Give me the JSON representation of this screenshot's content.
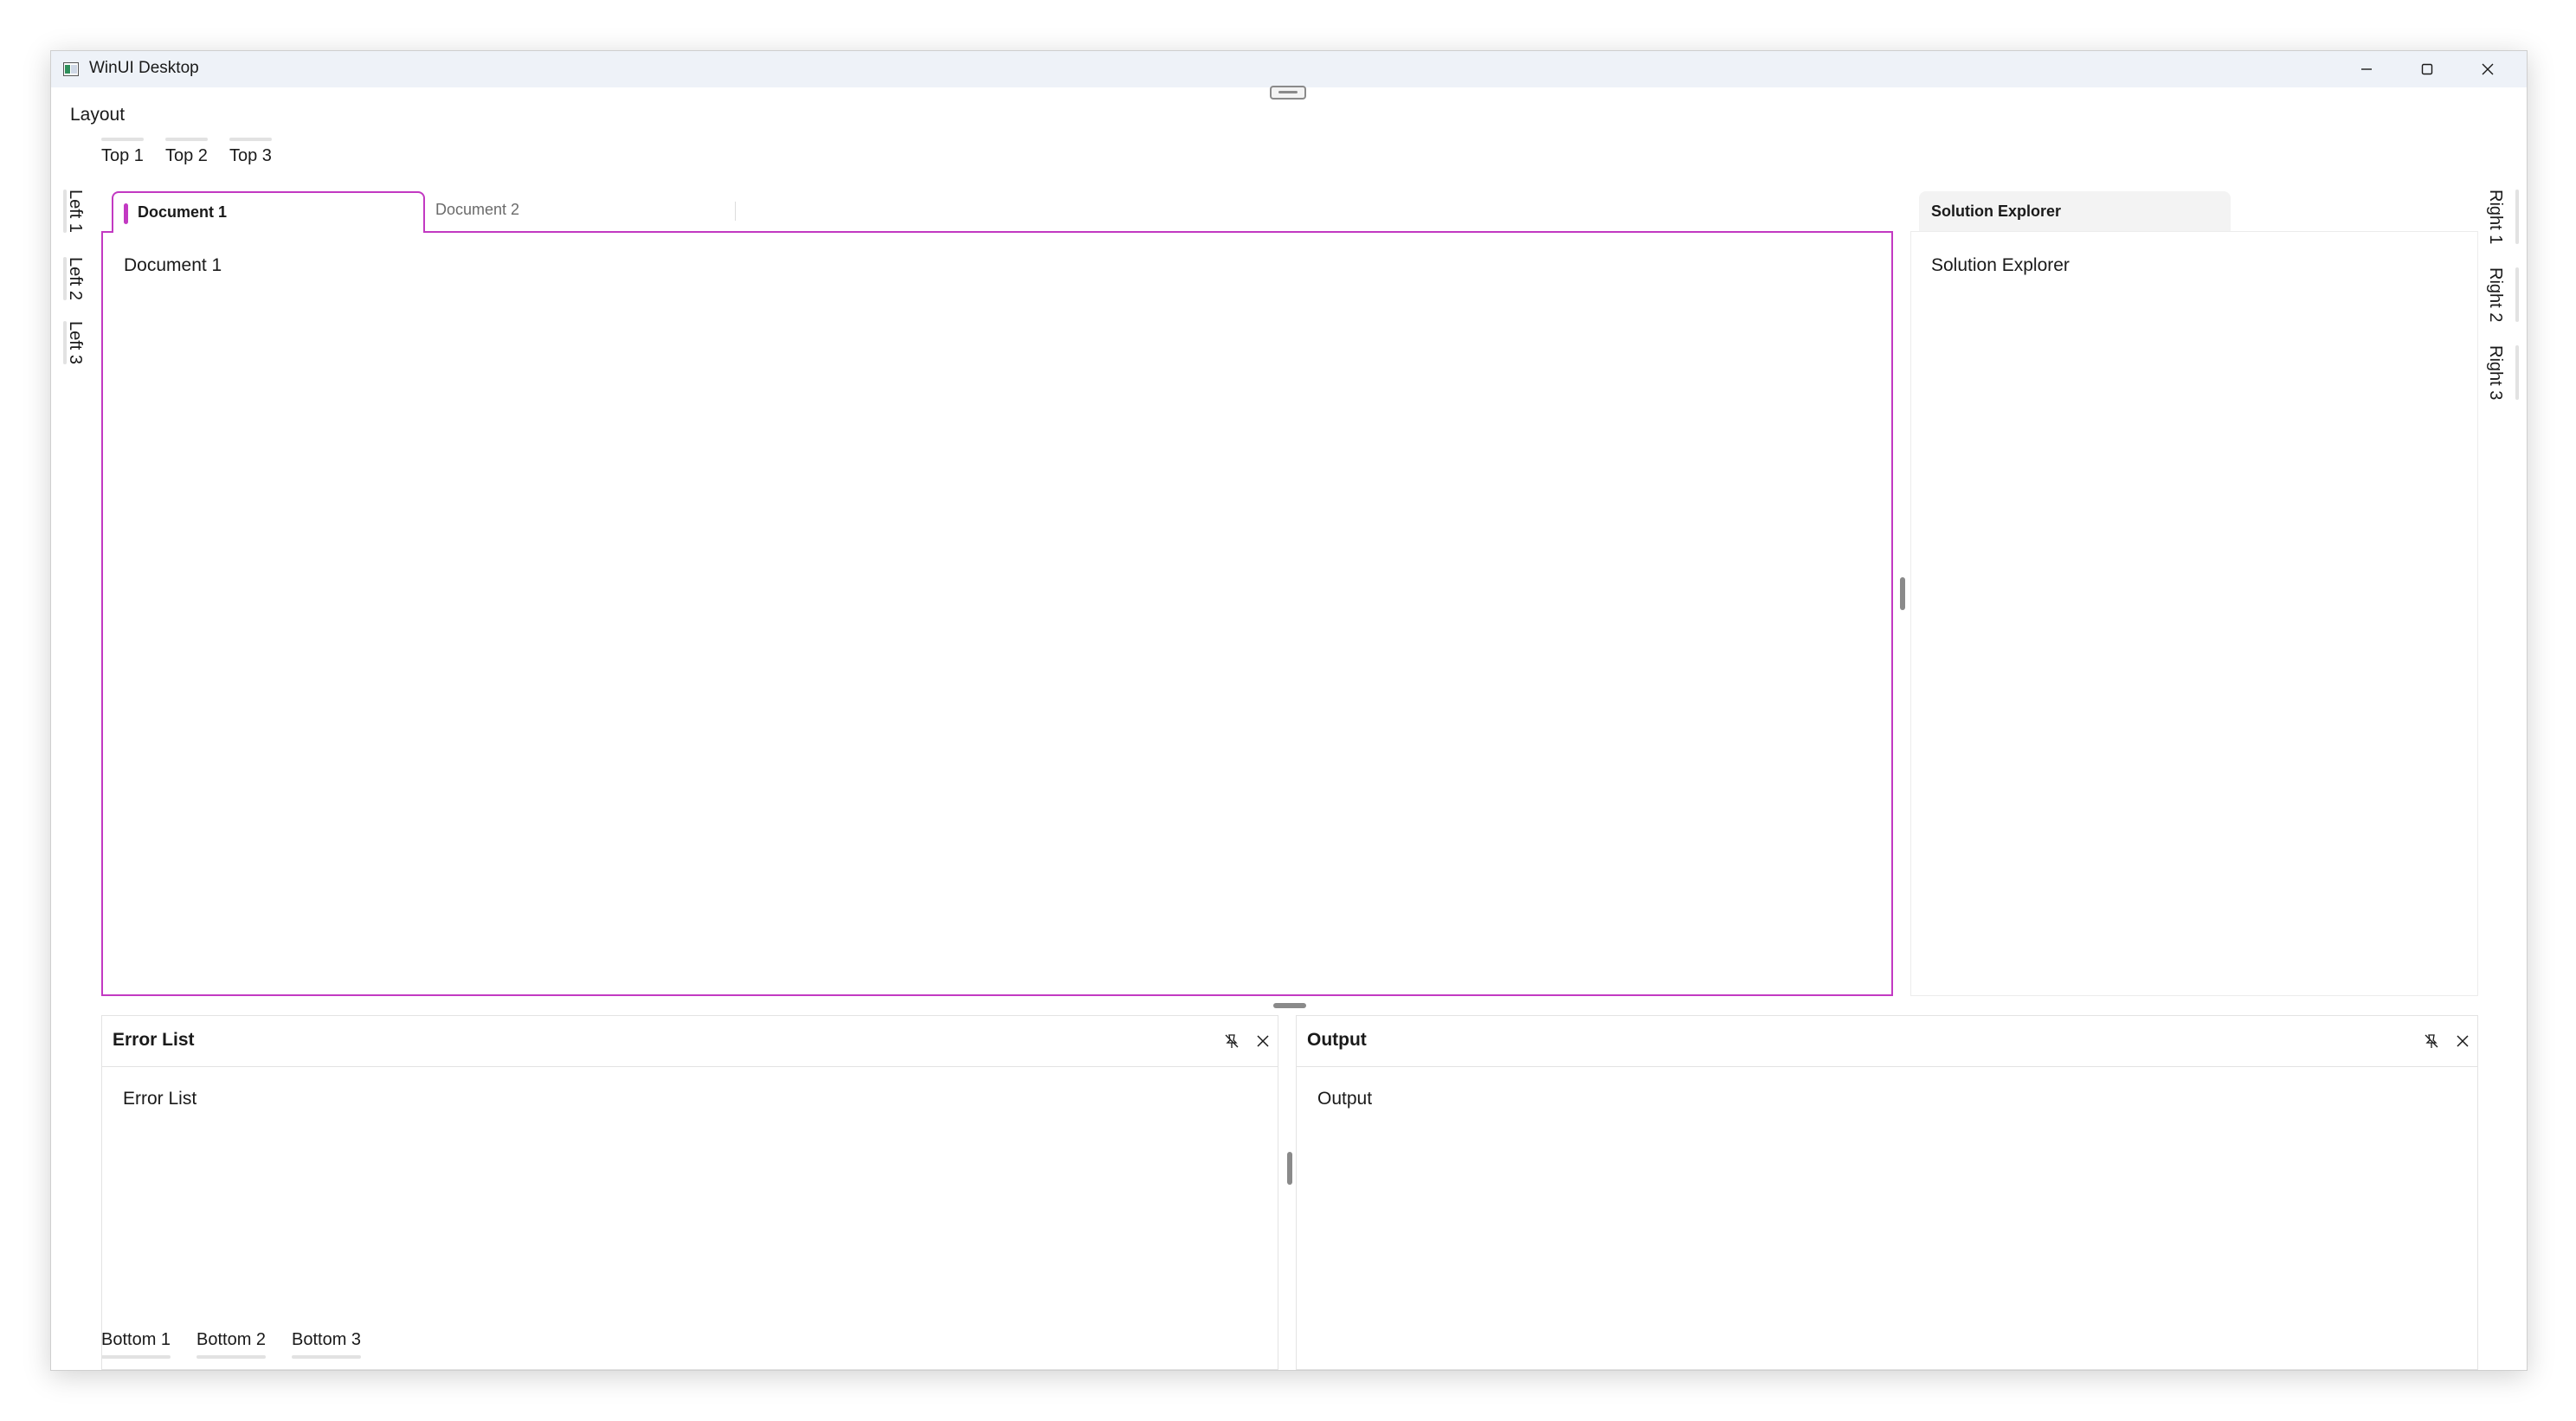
{
  "window": {
    "title": "WinUI Desktop"
  },
  "menu": {
    "layout_label": "Layout"
  },
  "top_tabs": [
    "Top 1",
    "Top 2",
    "Top 3"
  ],
  "left_tabs": [
    "Left 1",
    "Left 2",
    "Left 3"
  ],
  "right_tabs": [
    "Right 1",
    "Right 2",
    "Right 3"
  ],
  "bottom_tabs": [
    "Bottom 1",
    "Bottom 2",
    "Bottom 3"
  ],
  "documents": {
    "tabs": [
      "Document 1",
      "Document 2"
    ],
    "active_content": "Document 1",
    "accent": "#c239c2"
  },
  "solution_explorer": {
    "tab_label": "Solution Explorer",
    "content": "Solution Explorer"
  },
  "error_list": {
    "title": "Error List",
    "content": "Error List"
  },
  "output": {
    "title": "Output",
    "content": "Output"
  },
  "icons": {
    "app": "app-window-icon",
    "minimize": "minimize-icon",
    "maximize": "maximize-icon",
    "close": "close-icon",
    "unpin": "unpin-icon",
    "panel_close": "close-icon"
  }
}
